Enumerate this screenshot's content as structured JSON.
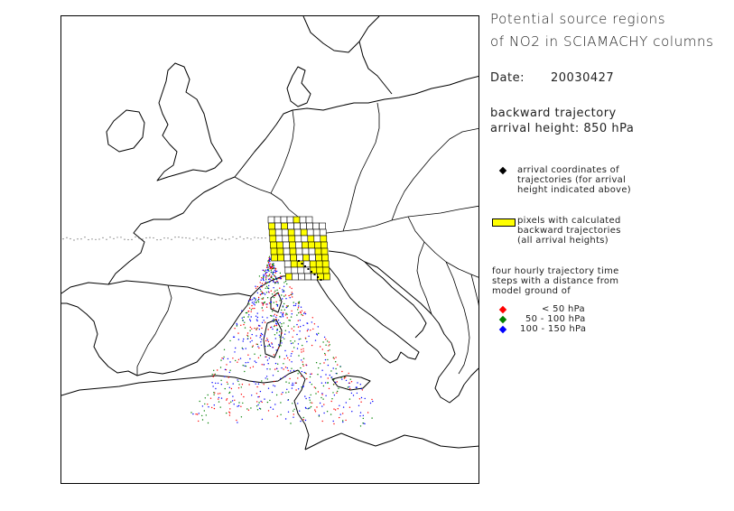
{
  "title": [
    "Potential source regions",
    "of NO2 in SCIAMACHY columns"
  ],
  "date": {
    "label": "Date:",
    "value": "20030427"
  },
  "trajectory": [
    "backward trajectory",
    "arrival height: 850 hPa"
  ],
  "legend": {
    "arrival": [
      "arrival coordinates of",
      "trajectories (for arrival",
      "height indicated above)"
    ],
    "pixels": [
      "pixels with calculated",
      "backward trajectories",
      "(all arrival heights)"
    ],
    "steps_intro": [
      "four hourly trajectory time",
      "steps with a distance from",
      "model ground of"
    ],
    "levels": [
      {
        "label": "< 50 hPa",
        "color": "#ff0000"
      },
      {
        "label": "50 - 100 hPa",
        "color": "#008000"
      },
      {
        "label": "100 - 150 hPa",
        "color": "#0000ff"
      }
    ],
    "arrival_color": "#000000",
    "pixel_color": "#ffff00"
  }
}
